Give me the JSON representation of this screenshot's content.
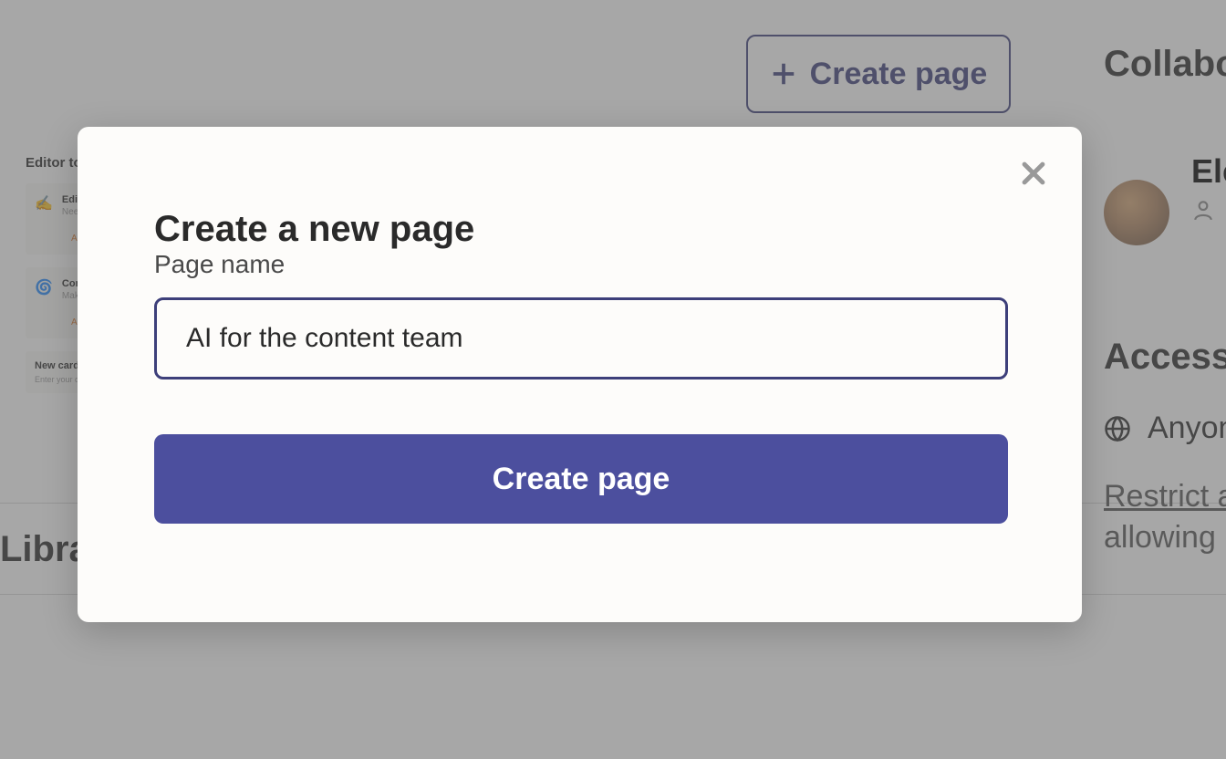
{
  "background": {
    "create_page_btn": "Create page",
    "sidebar_heading": "Editor too",
    "card1_title": "Edit",
    "card1_sub": "Nee",
    "card1_footer": "AI t",
    "card2_title": "Con",
    "card2_sub": "Mak",
    "card2_footer": "AI t",
    "new_card_title": "New card",
    "new_card_sub": "Enter your des",
    "library_heading": "Library",
    "right": {
      "collab_heading": "Collabo",
      "username": "Ele",
      "access_heading": "Access",
      "anyone_text": "Anyone",
      "restrict_link": "Restrict ac",
      "allowing_text": "allowing m"
    }
  },
  "modal": {
    "title": "Create a new page",
    "field_label": "Page name",
    "input_value": "AI for the content team",
    "submit_label": "Create page"
  }
}
